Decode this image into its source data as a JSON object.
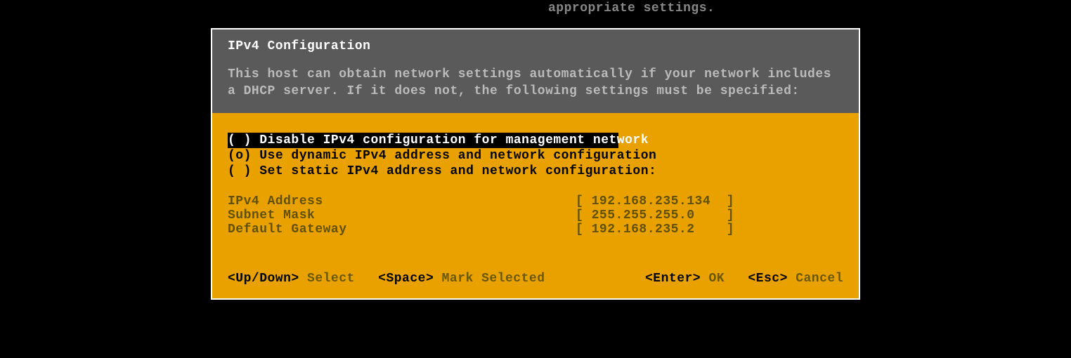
{
  "background_text": "appropriate settings.",
  "dialog": {
    "title": "IPv4 Configuration",
    "description": "This host can obtain network settings automatically if your network includes a DHCP server. If it does not, the following settings must be specified:",
    "options": [
      {
        "marker": "( )",
        "label": "Disable IPv4 configuration for management network",
        "selected": true
      },
      {
        "marker": "(o)",
        "label": "Use dynamic IPv4 address and network configuration",
        "selected": false
      },
      {
        "marker": "( )",
        "label": "Set static IPv4 address and network configuration:",
        "selected": false
      }
    ],
    "fields": [
      {
        "label": "IPv4 Address",
        "value": "192.168.235.134"
      },
      {
        "label": "Subnet Mask",
        "value": "255.255.255.0"
      },
      {
        "label": "Default Gateway",
        "value": "192.168.235.2"
      }
    ],
    "footer": {
      "updown_key": "<Up/Down>",
      "updown_action": "Select",
      "space_key": "<Space>",
      "space_action": "Mark Selected",
      "enter_key": "<Enter>",
      "enter_action": "OK",
      "esc_key": "<Esc>",
      "esc_action": "Cancel"
    }
  }
}
